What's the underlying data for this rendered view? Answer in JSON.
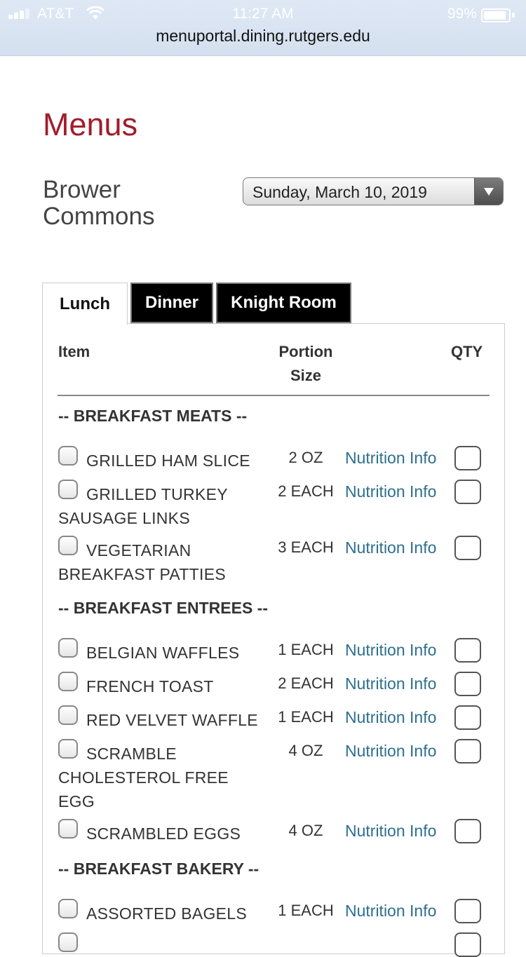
{
  "status_bar": {
    "carrier": "AT&T",
    "time": "11:27 AM",
    "battery": "99%",
    "url": "menuportal.dining.rutgers.edu"
  },
  "page": {
    "title": "Menus",
    "location": "Brower Commons",
    "date": "Sunday, March 10, 2019"
  },
  "tabs": [
    "Lunch",
    "Dinner",
    "Knight Room"
  ],
  "table": {
    "col_item": "Item",
    "col_portion": "Portion Size",
    "col_qty": "QTY"
  },
  "link_label": "Nutrition Info",
  "sections": [
    {
      "name": "-- BREAKFAST MEATS --",
      "items": [
        {
          "name": "GRILLED HAM SLICE",
          "portion": "2 OZ"
        },
        {
          "name": "GRILLED TURKEY SAUSAGE LINKS",
          "portion": "2 EACH"
        },
        {
          "name": "VEGETARIAN BREAKFAST PATTIES",
          "portion": "3 EACH"
        }
      ]
    },
    {
      "name": "-- BREAKFAST ENTREES --",
      "items": [
        {
          "name": "BELGIAN WAFFLES",
          "portion": "1 EACH"
        },
        {
          "name": "FRENCH TOAST",
          "portion": "2 EACH"
        },
        {
          "name": "RED VELVET WAFFLE",
          "portion": "1 EACH"
        },
        {
          "name": "SCRAMBLE CHOLESTEROL FREE EGG",
          "portion": "4 OZ"
        },
        {
          "name": "SCRAMBLED EGGS",
          "portion": "4 OZ"
        }
      ]
    },
    {
      "name": "-- BREAKFAST BAKERY --",
      "items": [
        {
          "name": "ASSORTED BAGELS",
          "portion": "1 EACH"
        }
      ]
    }
  ]
}
